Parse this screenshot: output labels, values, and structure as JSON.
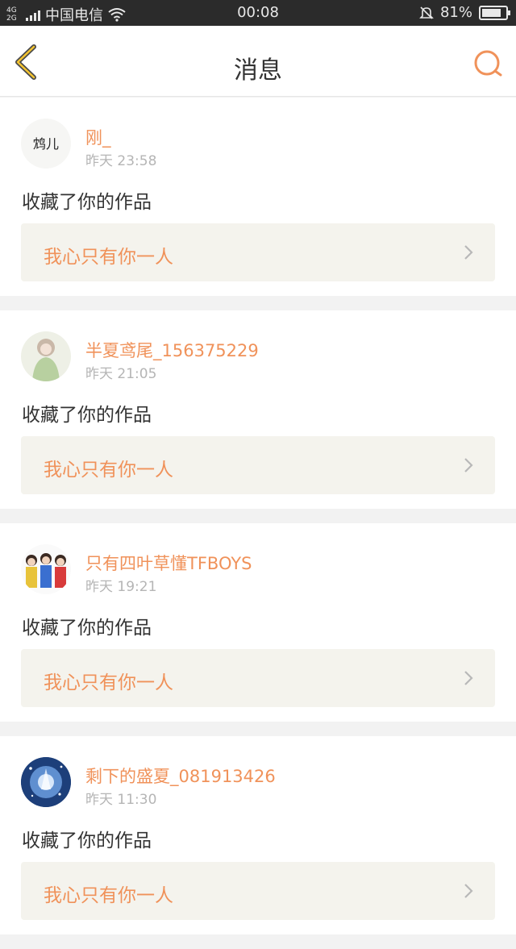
{
  "status_bar": {
    "network": "4G 2G",
    "carrier": "中国电信",
    "time": "00:08",
    "battery": "81%",
    "battery_level": 0.81
  },
  "header": {
    "title": "消息",
    "back_icon": "chevron-left-icon",
    "search_icon": "search-icon",
    "accent": "#f0925a"
  },
  "messages": [
    {
      "user": "刚_",
      "time": "昨天 23:58",
      "action": "收藏了你的作品",
      "work_title": "我心只有你一人",
      "avatar_text": "鸩儿"
    },
    {
      "user": "半夏鸢尾_156375229",
      "time": "昨天 21:05",
      "action": "收藏了你的作品",
      "work_title": "我心只有你一人"
    },
    {
      "user": "只有四叶草懂TFBOYS",
      "time": "昨天 19:21",
      "action": "收藏了你的作品",
      "work_title": "我心只有你一人"
    },
    {
      "user": "剩下的盛夏_081913426",
      "time": "昨天 11:30",
      "action": "收藏了你的作品",
      "work_title": "我心只有你一人"
    }
  ]
}
